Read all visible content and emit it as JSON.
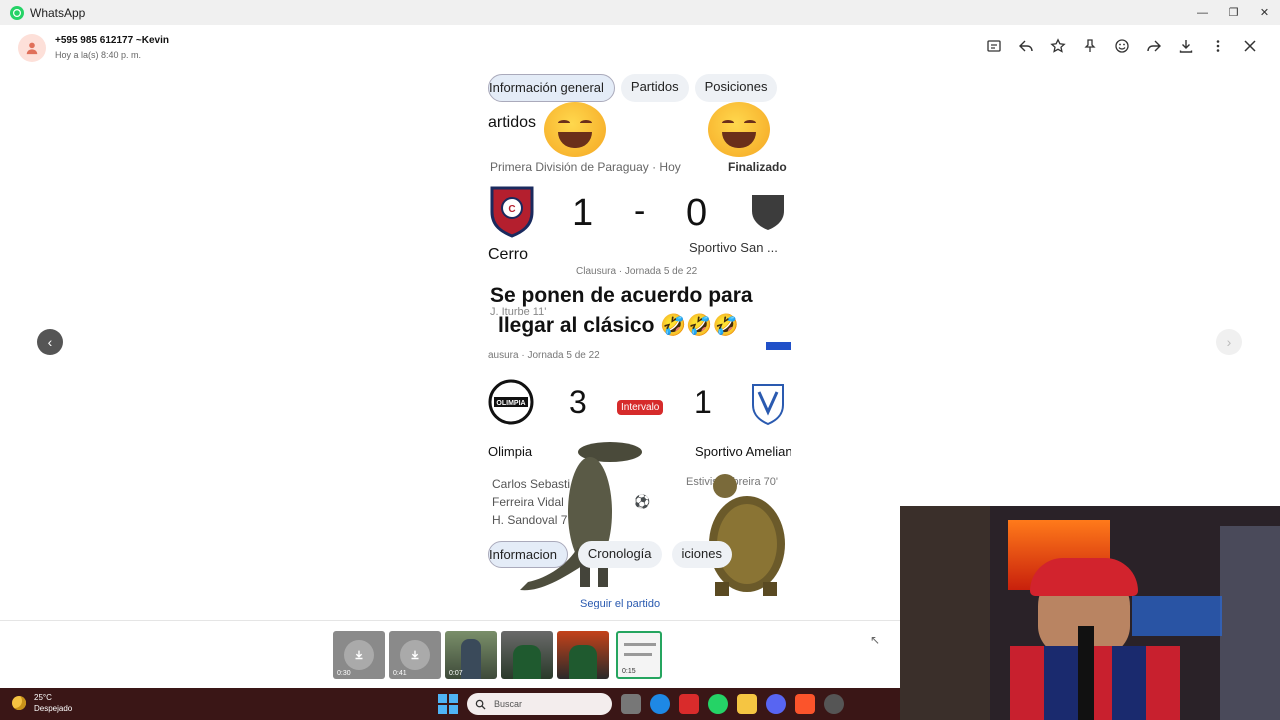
{
  "window": {
    "title": "WhatsApp"
  },
  "header": {
    "contact_name": "+595 985 612177 ~Kevin",
    "timestamp": "Hoy a la(s) 8:40 p. m."
  },
  "toolbar": {
    "icons": [
      "message-icon",
      "reply-icon",
      "star-icon",
      "pin-icon",
      "emoji-icon",
      "forward-icon",
      "download-icon",
      "more-icon",
      "close-icon"
    ]
  },
  "media": {
    "chips_top": [
      "Información general",
      "Partidos",
      "Posiciones"
    ],
    "partidos_label": "artidos",
    "league_line": "Primera División de Paraguay · Hoy",
    "status_final": "Finalizado",
    "match1": {
      "home_score": "1",
      "dash": "-",
      "away_score": "0",
      "home": "Cerro",
      "away": "Sportivo San ..."
    },
    "round_line": "Clausura · Jornada 5 de 22",
    "caption_line1": "Se ponen de acuerdo para",
    "caption_line2": "llegar al clásico 🤣🤣🤣",
    "scorer1": "J. Iturbe 11'",
    "round_line2": "ausura · Jornada 5 de 22",
    "match2": {
      "home_score": "3",
      "status": "Intervalo",
      "away_score": "1",
      "home": "Olimpia",
      "away": "Sportivo Amelian"
    },
    "crest_olimpia_text": "OLIMPIA",
    "scorers_home": [
      "Carlos Sebasti",
      "Ferreira Vidal",
      "H. Sandoval 7"
    ],
    "scorer_away": "Estivis.zobreira 70'",
    "chips_bottom": [
      "Informacion",
      "Cronología",
      "iciones"
    ],
    "follow": "Seguir el partido"
  },
  "thumbnails": [
    {
      "type": "download",
      "duration": "0:30"
    },
    {
      "type": "download",
      "duration": "0:41"
    },
    {
      "type": "video",
      "duration": "0:07"
    },
    {
      "type": "image",
      "duration": ""
    },
    {
      "type": "image",
      "duration": ""
    },
    {
      "type": "video",
      "duration": "0:15",
      "selected": true
    }
  ],
  "taskbar": {
    "temperature": "25°C",
    "weather": "Despejado",
    "search_placeholder": "Buscar"
  }
}
